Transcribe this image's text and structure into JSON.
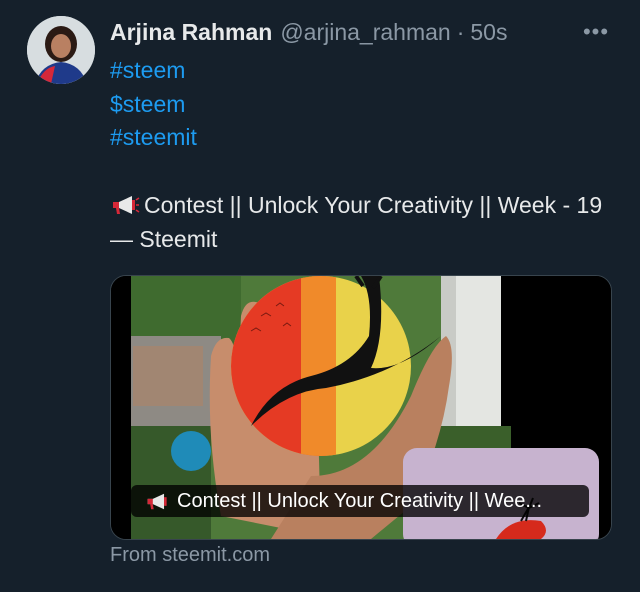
{
  "tweet": {
    "display_name": "Arjina Rahman",
    "handle": "@arjina_rahman",
    "separator": "·",
    "time": "50s",
    "more_glyph": "•••",
    "tags": [
      "#steem",
      "$steem",
      "#steemit"
    ],
    "body_text": "Contest || Unlock Your Creativity || Week - 19 — Steemit",
    "link_color": "#1d9bf0"
  },
  "card": {
    "title": "Contest || Unlock Your Creativity || Wee...",
    "source": "From steemit.com"
  },
  "icons": {
    "megaphone": "megaphone-icon",
    "more": "more-options-icon"
  }
}
